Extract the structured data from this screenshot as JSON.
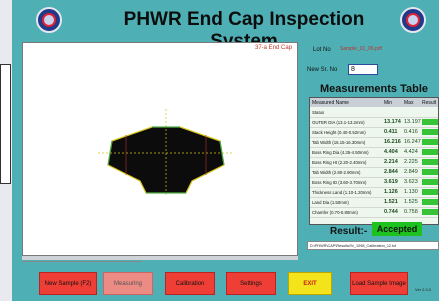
{
  "app": {
    "title": "PHWR End Cap Inspection System",
    "version": "Ver 2.0.0"
  },
  "image_panel": {
    "tag": "37-a End Cap",
    "file_path": "D:\\PHWR\\CAP\\Images\\Sr_1098.bmp"
  },
  "right": {
    "lot_label": "Lot No",
    "lot_value": "Sample_01_06.pdf",
    "sr_label": "New Sr. No",
    "sr_value": "8",
    "measurements_title": "Measurements Table",
    "table": {
      "headers": [
        "Measured Name",
        "Min",
        "Max",
        "Result"
      ],
      "rows": [
        {
          "name": "Status",
          "v1": "",
          "v2": ""
        },
        {
          "name": "OUTER DIA (13.1-13.2mm)",
          "v1": "13.174",
          "v2": "13.197"
        },
        {
          "name": "Stack Height (0.40-0.52mm)",
          "v1": "0.411",
          "v2": "0.416"
        },
        {
          "name": "Tab Width (16.15-16.30mm)",
          "v1": "16.216",
          "v2": "16.247"
        },
        {
          "name": "Boss Ring Dia (4.35-4.50mm)",
          "v1": "4.404",
          "v2": "4.424"
        },
        {
          "name": "Boss Ring Ht (2.20-2.40mm)",
          "v1": "2.214",
          "v2": "2.225"
        },
        {
          "name": "Tab Width (2.80-2.90mm)",
          "v1": "2.844",
          "v2": "2.849"
        },
        {
          "name": "Boss Ring ID (3.60-3.70mm)",
          "v1": "3.619",
          "v2": "3.623"
        },
        {
          "name": "Thickness Land (1.10-1.20mm)",
          "v1": "1.126",
          "v2": "1.130"
        },
        {
          "name": "Land Dia (1.50mm)",
          "v1": "1.521",
          "v2": "1.525"
        },
        {
          "name": "Chamfer (0.70-0.80mm)",
          "v1": "0.744",
          "v2": "0.758"
        }
      ]
    },
    "result_label": "Result:-",
    "result_value": "Accepted",
    "result_file_path": "D:\\PHWR\\CAP\\Results\\Sr_1098_Calibration_12.txt"
  },
  "buttons": {
    "new_sample": "New Sample (F2)",
    "measuring": "Measuring",
    "calibration": "Calibration",
    "settings": "Settings",
    "exit": "EXIT",
    "load_sample": "Load Sample Image"
  },
  "colors": {
    "background": "#4eb0b5",
    "accepted": "#1ec21e",
    "button_red": "#ef3e35",
    "exit_yellow": "#f2e31a"
  }
}
